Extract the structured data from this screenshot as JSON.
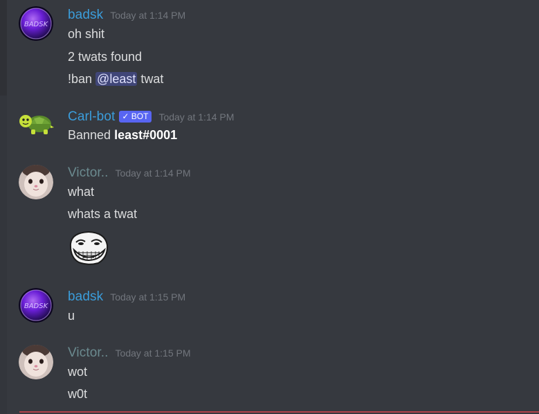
{
  "messages": [
    {
      "username": "badsk",
      "timestamp": "Today at 1:14 PM",
      "avatar": "purple-orb-avatar",
      "lines": [
        "oh shit",
        "2 twats found"
      ],
      "command": {
        "pre": "!ban ",
        "mention": "@least",
        "post": " twat"
      }
    },
    {
      "username": "Carl-bot",
      "badge": "✓ BOT",
      "timestamp": "Today at 1:14 PM",
      "avatar": "turtle-avatar",
      "banned_prefix": "Banned ",
      "banned_user": "least#0001"
    },
    {
      "username": "Victor..",
      "timestamp": "Today at 1:14 PM",
      "avatar": "cat-face-avatar",
      "lines": [
        "what",
        "whats a twat"
      ],
      "emoji": "trollface-emoji"
    },
    {
      "username": "badsk",
      "timestamp": "Today at 1:15 PM",
      "avatar": "purple-orb-avatar",
      "lines": [
        "u"
      ]
    },
    {
      "username": "Victor..",
      "timestamp": "Today at 1:15 PM",
      "avatar": "cat-face-avatar",
      "lines": [
        "wot",
        "w0t"
      ]
    }
  ],
  "colors": {
    "background": "#36393f",
    "username_blue": "#3b9ddb",
    "username_gray": "#6b8a8f",
    "text": "#dcddde",
    "timestamp": "#72767d",
    "bot_badge": "#5865f2",
    "new_messages_divider": "#b4434b"
  }
}
